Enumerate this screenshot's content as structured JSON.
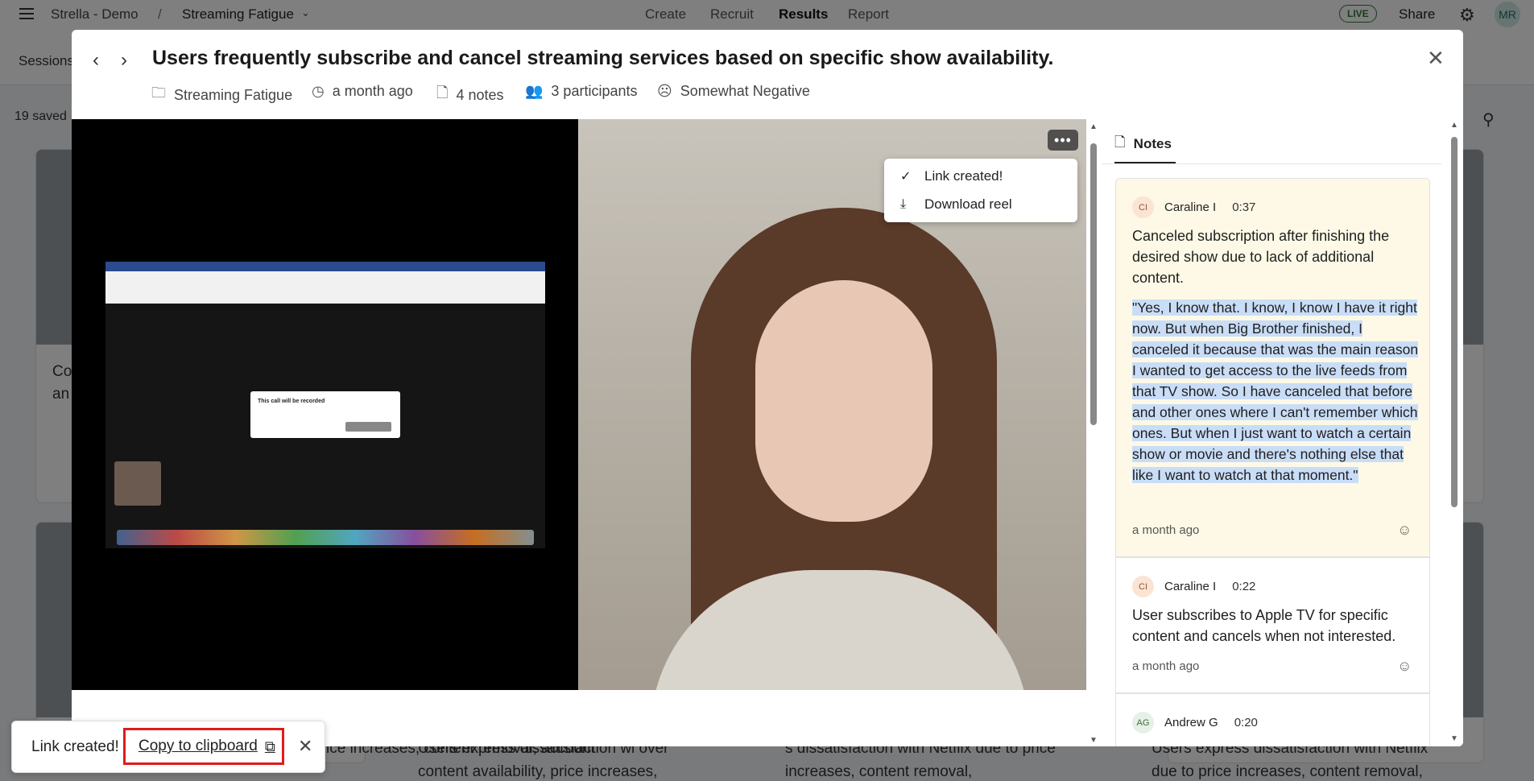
{
  "topbar": {
    "app_name": "Strella - Demo",
    "separator": "/",
    "project": "Streaming Fatigue",
    "nav": [
      "Create",
      "Recruit",
      "Results",
      "Report"
    ],
    "active_nav": "Results",
    "live_badge": "LIVE",
    "share": "Share",
    "avatar": "MR",
    "accent_color": "#2e7d32"
  },
  "subbar": {
    "sessions_tab": "Sessions",
    "saved_count": "19 saved"
  },
  "background_cards": {
    "card1_fragment": "Co an",
    "bottom_1": "ice increases, content removal, account",
    "bottom_2": "Users express dissatisfaction wi over content availability, price increases,",
    "bottom_3": "s dissatisfaction with Netflix due to price increases, content removal,",
    "bottom_4": "Users express dissatisfaction with Netflix due to price increases, content removal,"
  },
  "modal": {
    "title": "Users frequently subscribe and cancel streaming services based on specific show availability.",
    "meta": {
      "project": "Streaming Fatigue",
      "time": "a month ago",
      "notes": "4 notes",
      "participants": "3 participants",
      "sentiment": "Somewhat Negative"
    },
    "video": {
      "shared_screen_dialog": "This call will be recorded",
      "more_button": "•••",
      "menu": {
        "link_created": "Link created!",
        "download": "Download reel"
      }
    },
    "notes_panel": {
      "tab_label": "Notes",
      "notes": [
        {
          "initials": "CI",
          "author": "Caraline I",
          "timestamp": "0:37",
          "summary": "Canceled subscription after finishing the desired show due to lack of additional content.",
          "quote": "\"Yes, I know that. I know, I know I have it right now. But when Big Brother finished, I canceled it because that was the main reason I wanted to get access to the live feeds from that TV show. So I have canceled that before and other ones where I can't remember which ones. But when I just want to watch a certain show or movie and there's nothing else that like I want to watch at that moment.\"",
          "ago": "a month ago"
        },
        {
          "initials": "CI",
          "author": "Caraline I",
          "timestamp": "0:22",
          "summary": "User subscribes to Apple TV for specific content and cancels when not interested.",
          "ago": "a month ago"
        },
        {
          "initials": "AG",
          "author": "Andrew G",
          "timestamp": "0:20"
        }
      ]
    }
  },
  "toast": {
    "message": "Link created!",
    "copy_label": "Copy to clipboard"
  }
}
